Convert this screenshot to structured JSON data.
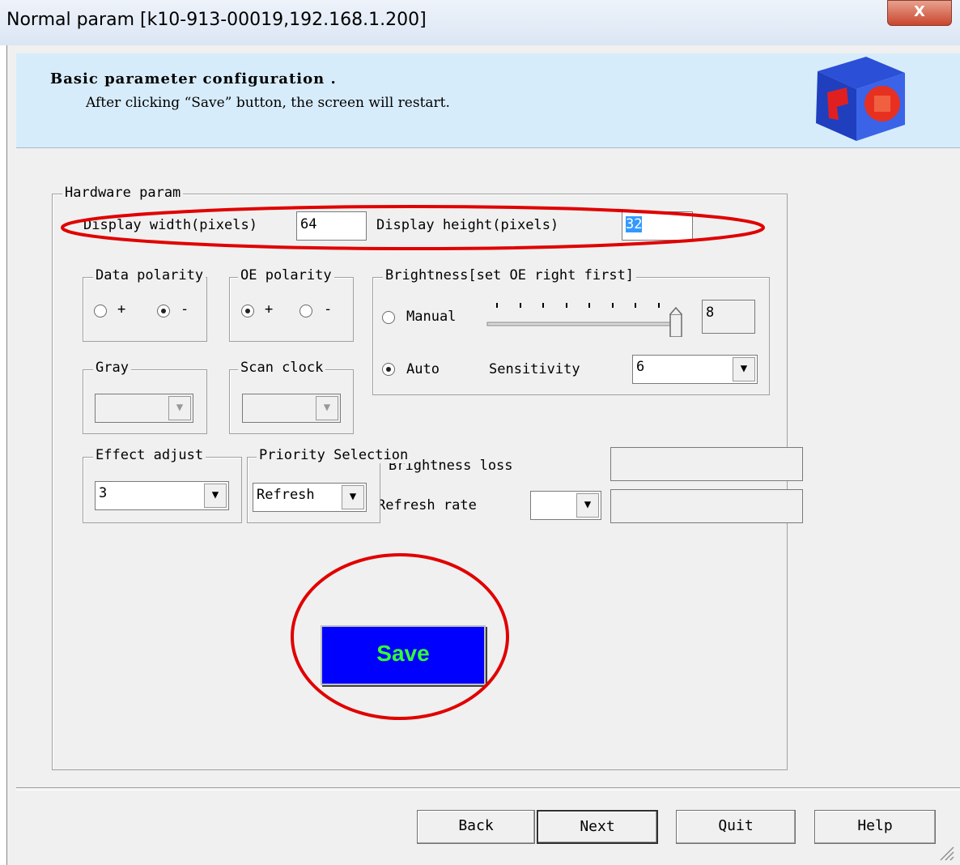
{
  "window": {
    "title": "Normal param [k10-913-00019,192.168.1.200]",
    "close_glyph": "X"
  },
  "banner": {
    "title": "Basic parameter configuration .",
    "subtitle": "After clicking “Save” button, the screen will restart."
  },
  "hardware": {
    "legend": "Hardware param",
    "width_label": "Display width(pixels)",
    "width_value": "64",
    "height_label": "Display height(pixels)",
    "height_value": "32"
  },
  "data_polarity": {
    "legend": "Data polarity",
    "plus": "+",
    "minus": "-",
    "selected": "-"
  },
  "oe_polarity": {
    "legend": "OE polarity",
    "plus": "+",
    "minus": "-",
    "selected": "+"
  },
  "brightness": {
    "legend": "Brightness[set OE right first]",
    "manual_label": "Manual",
    "manual_value": "8",
    "slider_level": 8,
    "auto_label": "Auto",
    "sensitivity_label": "Sensitivity",
    "sensitivity_value": "6",
    "selected": "Auto"
  },
  "gray": {
    "legend": "Gray",
    "value": ""
  },
  "scan_clock": {
    "legend": "Scan clock",
    "value": ""
  },
  "effect": {
    "legend": "Effect adjust",
    "value": "3"
  },
  "priority": {
    "legend": "Priority Selection",
    "value": "Refresh"
  },
  "brightness_loss": {
    "label": "Brightness loss",
    "value": ""
  },
  "refresh_rate": {
    "label": "Refresh rate",
    "value": ""
  },
  "save_label": "Save",
  "footer": {
    "back": "Back",
    "next": "Next",
    "quit": "Quit",
    "help": "Help"
  },
  "colors": {
    "save_bg": "#0000ff",
    "save_text": "#33ff33",
    "annotation": "#e00000",
    "banner_bg": "#d7ecfa"
  },
  "icons": {
    "logo": "cube-logo-icon"
  }
}
